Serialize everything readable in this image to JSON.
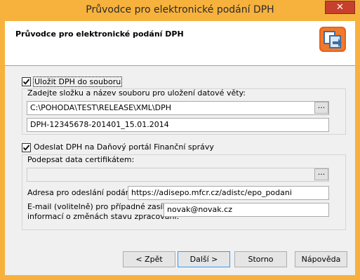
{
  "window": {
    "title": "Průvodce pro elektronické podání DPH",
    "close_label": "✕"
  },
  "header": {
    "title": "Průvodce pro elektronické podání DPH",
    "logo_icon": "wizard-logo-icon"
  },
  "save_section": {
    "checkbox_label": "Uložit DPH do souboru",
    "checked": true,
    "prompt": "Zadejte složku a název souboru pro uložení datové věty:",
    "folder_value": "C:\\POHODA\\TEST\\RELEASE\\XML\\DPH",
    "browse_label": "...",
    "file_value": "DPH-12345678-201401_15.01.2014"
  },
  "send_section": {
    "checkbox_label": "Odeslat DPH na Daňový portál Finanční správy",
    "checked": true,
    "sign_label": "Podepsat data certifikátem:",
    "certificate_value": "",
    "browse_label": "...",
    "address_label": "Adresa pro odeslání podání:",
    "address_value": "https://adisepo.mfcr.cz/adistc/epo_podani",
    "email_label_line1": "E-mail (volitelně) pro případné zasílání",
    "email_label_line2": "informací o změnách stavu zpracování:",
    "email_value": "novak@novak.cz"
  },
  "buttons": {
    "back": "< Zpět",
    "next": "Další >",
    "cancel": "Storno",
    "help": "Nápověda"
  },
  "colors": {
    "titlebar": "#f7b23d",
    "close": "#c7402d",
    "focus_border": "#3399ff"
  }
}
